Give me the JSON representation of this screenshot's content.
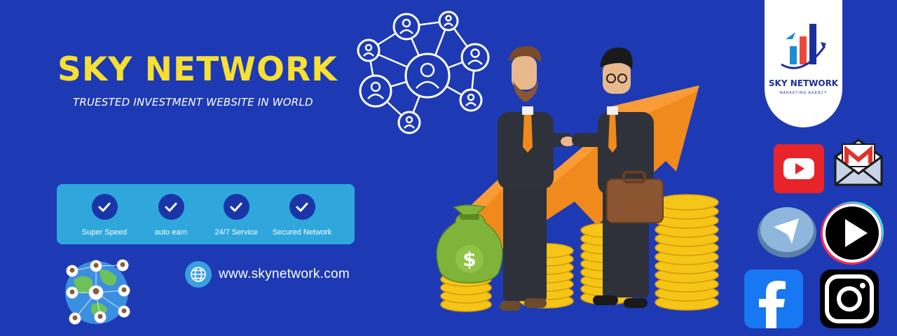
{
  "brand": {
    "title": "SKY NETWORK",
    "tagline": "TRUESTED INVESTMENT WEBSITE IN WORLD"
  },
  "features": [
    {
      "label": "Super Speed",
      "icon": "check-icon"
    },
    {
      "label": "auto earn",
      "icon": "check-icon"
    },
    {
      "label": "24/7 Service",
      "icon": "check-icon"
    },
    {
      "label": "Secured Network",
      "icon": "check-icon"
    }
  ],
  "website": {
    "url": "www.skynetwork.com",
    "icon": "globe-icon"
  },
  "logo": {
    "name": "SKY NETWORK",
    "subtitle": "MARKETING AGENCY"
  },
  "social_icons": [
    "youtube-icon",
    "gmail-icon",
    "telegram-icon",
    "play-icon",
    "facebook-icon",
    "instagram-icon"
  ],
  "colors": {
    "background": "#1d3ab4",
    "title": "#f7df33",
    "feature_panel": "#2fa7dc",
    "check_circle": "#1a35a8",
    "arrow": "#f08a1c",
    "coin": "#f5c518"
  }
}
